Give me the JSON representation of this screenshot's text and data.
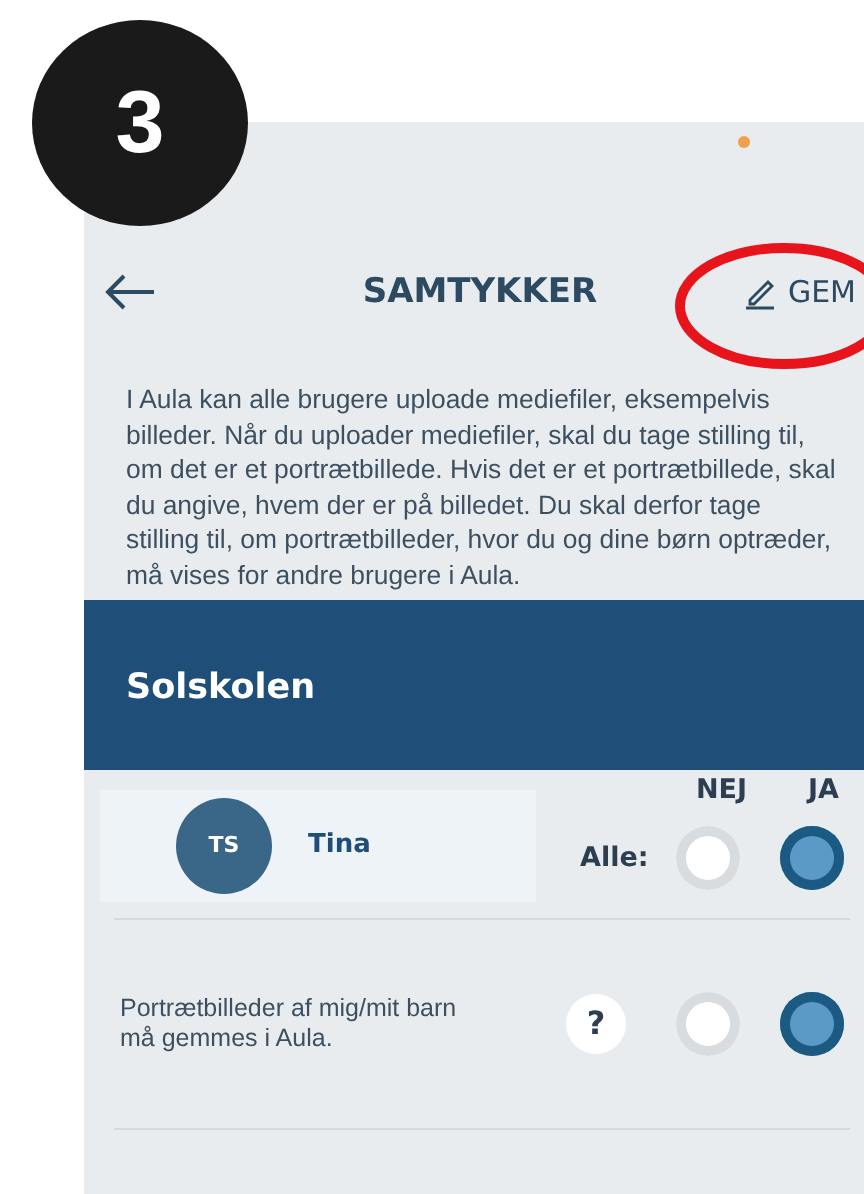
{
  "step_badge": "3",
  "header": {
    "title": "SAMTYKKER",
    "save_label": "GEM"
  },
  "description": "I Aula kan alle brugere uploade mediefiler, eksempelvis billeder. Når du uploader mediefiler, skal du tage stilling til, om det er et portrætbillede. Hvis det er et portrætbillede, skal du angive, hvem der er på billedet. Du skal derfor tage stilling til, om portrætbilleder, hvor du og dine børn optræder, må vises for andre brugere i Aula.",
  "institution": "Solskolen",
  "columns": [
    "NEJ",
    "JA"
  ],
  "person": {
    "initials": "TS",
    "name": "Tina",
    "all_label": "Alle:",
    "options": [
      {
        "selected": false
      },
      {
        "selected": true
      }
    ]
  },
  "consents": [
    {
      "text": "Portrætbilleder af mig/mit barn må gemmes i Aula.",
      "help": "?",
      "options": [
        {
          "selected": false
        },
        {
          "selected": true
        }
      ]
    }
  ]
}
